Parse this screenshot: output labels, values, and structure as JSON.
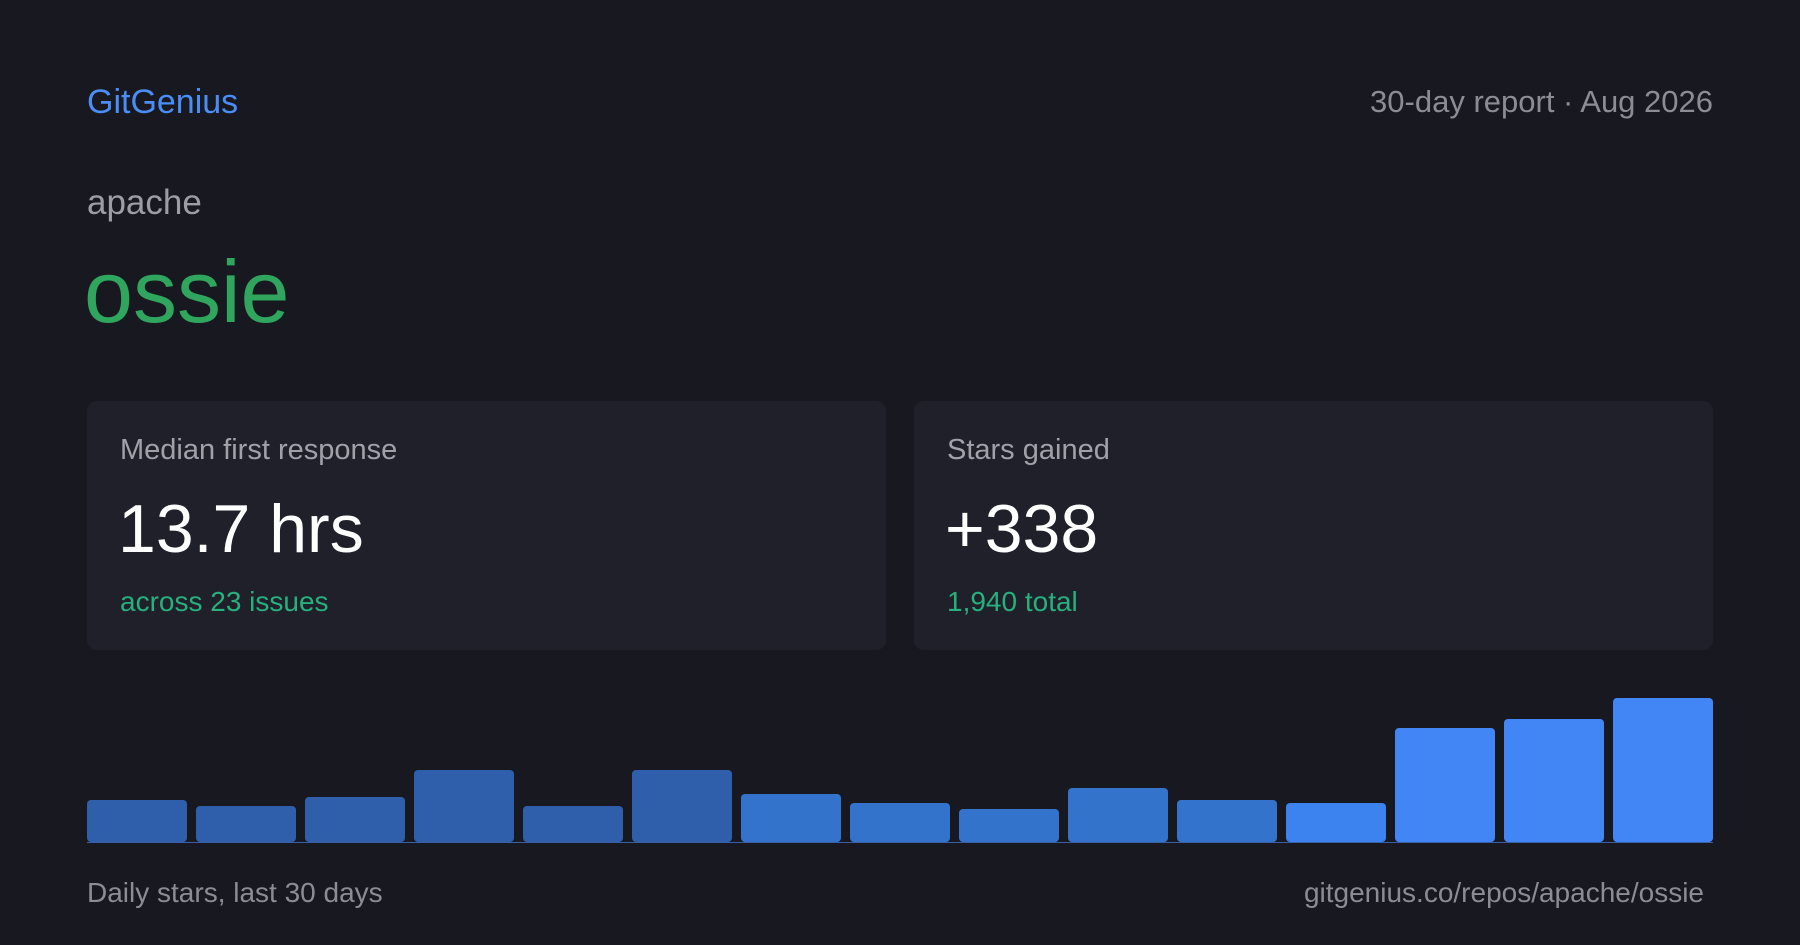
{
  "header": {
    "brand": "GitGenius",
    "report_label": "30-day report · Aug 2026"
  },
  "repo": {
    "owner": "apache",
    "name": "ossie"
  },
  "cards": [
    {
      "label": "Median first response",
      "value": "13.7 hrs",
      "sub": "across 23 issues"
    },
    {
      "label": "Stars gained",
      "value": "+338",
      "sub": "1,940 total"
    }
  ],
  "chart_data": {
    "type": "bar",
    "values": [
      7,
      6,
      7.5,
      12,
      6,
      12,
      8,
      6.5,
      5.5,
      9,
      7,
      6.5,
      19,
      20.5,
      24
    ],
    "ylim": [
      0,
      24
    ],
    "colors": [
      "#2f5fab",
      "#2f5fab",
      "#2f5fab",
      "#2f5fab",
      "#2f5fab",
      "#2f5fab",
      "#3473cc",
      "#3473cc",
      "#3473cc",
      "#3473cc",
      "#3473cc",
      "#3d83f0",
      "#4286f5",
      "#4286f5",
      "#4286f5"
    ],
    "baseline_color": "#3a5fa3",
    "grid": false
  },
  "footer": {
    "caption": "Daily stars, last 30 days",
    "url": "gitgenius.co/repos/apache/ossie"
  }
}
